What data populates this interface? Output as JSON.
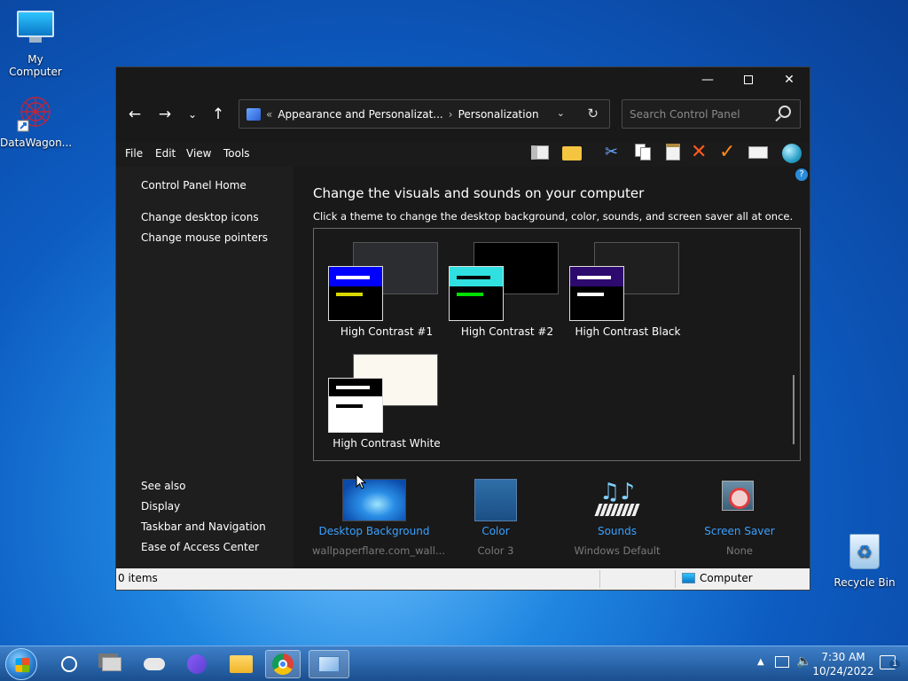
{
  "desktop": {
    "icons": [
      {
        "label": "My Computer"
      },
      {
        "label": "DataWagon..."
      },
      {
        "label": "Recycle Bin"
      }
    ]
  },
  "window": {
    "address": {
      "overflow": "«",
      "crumb1": "Appearance and Personalizat...",
      "separator": "›",
      "crumb2": "Personalization"
    },
    "search_placeholder": "Search Control Panel",
    "menu": [
      "File",
      "Edit",
      "View",
      "Tools"
    ],
    "sidebar": {
      "home": "Control Panel Home",
      "links": [
        "Change desktop icons",
        "Change mouse pointers"
      ],
      "see_also_title": "See also",
      "see_also": [
        "Display",
        "Taskbar and Navigation",
        "Ease of Access Center"
      ]
    },
    "main": {
      "title": "Change the visuals and sounds on your computer",
      "description": "Click a theme to change the desktop background, color, sounds, and screen saver all at once.",
      "themes": [
        {
          "name": "High Contrast #1",
          "bar_color": "#0000ff",
          "line1": "#ffffff",
          "line2": "#d9d900",
          "bg": "#2b2d31",
          "win_bg": "#000000"
        },
        {
          "name": "High Contrast #2",
          "bar_color": "#30e0e0",
          "line1": "#000000",
          "line2": "#00e000",
          "bg": "#000000",
          "win_bg": "#000000"
        },
        {
          "name": "High Contrast Black",
          "bar_color": "#2d0a6e",
          "line1": "#ffffff",
          "line2": "#ffffff",
          "bg": "#1f1f1f",
          "win_bg": "#000000"
        },
        {
          "name": "High Contrast White",
          "bar_color": "#000000",
          "line1": "#ffffff",
          "line2": "#000000",
          "bg": "#fbf8ef",
          "win_bg": "#ffffff"
        }
      ],
      "bottom": [
        {
          "label": "Desktop Background",
          "value": "wallpaperflare.com_wall..."
        },
        {
          "label": "Color",
          "value": "Color 3"
        },
        {
          "label": "Sounds",
          "value": "Windows Default"
        },
        {
          "label": "Screen Saver",
          "value": "None"
        }
      ]
    },
    "status": {
      "items": "0 items",
      "location": "Computer"
    }
  },
  "taskbar": {
    "clock_time": "7:30 AM",
    "clock_date": "10/24/2022",
    "notification_count": "1"
  }
}
